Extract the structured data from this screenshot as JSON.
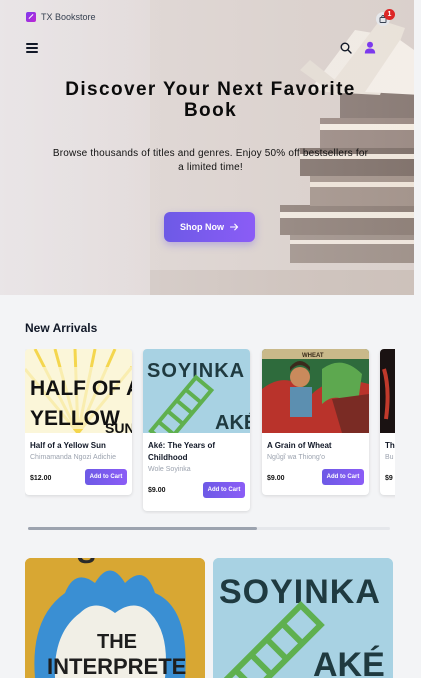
{
  "header": {
    "brand_name": "TX Bookstore",
    "cart_count": "1"
  },
  "hero": {
    "title": "Discover Your Next Favorite Book",
    "subtitle": "Browse thousands of titles and genres. Enjoy 50% off bestsellers for a limited time!",
    "cta_label": "Shop Now"
  },
  "new_arrivals": {
    "title": "New Arrivals",
    "books": [
      {
        "title": "Half of a Yellow Sun",
        "author": "Chimamanda Ngozi Adichie",
        "price": "$12.00",
        "add_label": "Add to Cart",
        "cover_text": [
          "HALF OF A",
          "YELLOW",
          "SUN"
        ]
      },
      {
        "title": "Aké: The Years of Childhood",
        "author": "Wole Soyinka",
        "price": "$9.00",
        "add_label": "Add to Cart",
        "cover_text": [
          "SOYINKA",
          "AKÉ"
        ]
      },
      {
        "title": "A Grain of Wheat",
        "author": "Ngũgĩ wa Thiong'o",
        "price": "$9.00",
        "add_label": "Add to Cart",
        "cover_text": [
          "WHEAT"
        ]
      },
      {
        "title": "Th",
        "author": "Bu",
        "price": "$9",
        "add_label": "",
        "cover_text": []
      }
    ]
  },
  "featured": {
    "covers": [
      {
        "cover_text": [
          "S",
          "THE",
          "INTERPRETE"
        ]
      },
      {
        "cover_text": [
          "SOYINKA",
          "AKÉ"
        ]
      }
    ]
  },
  "colors": {
    "accent": "#7c5cf0",
    "badge": "#dc2626",
    "user_icon": "#7c3aed"
  },
  "icons": [
    "brand-logo-icon",
    "shopping-bag-icon",
    "menu-icon",
    "search-icon",
    "user-icon",
    "arrow-right-icon"
  ]
}
